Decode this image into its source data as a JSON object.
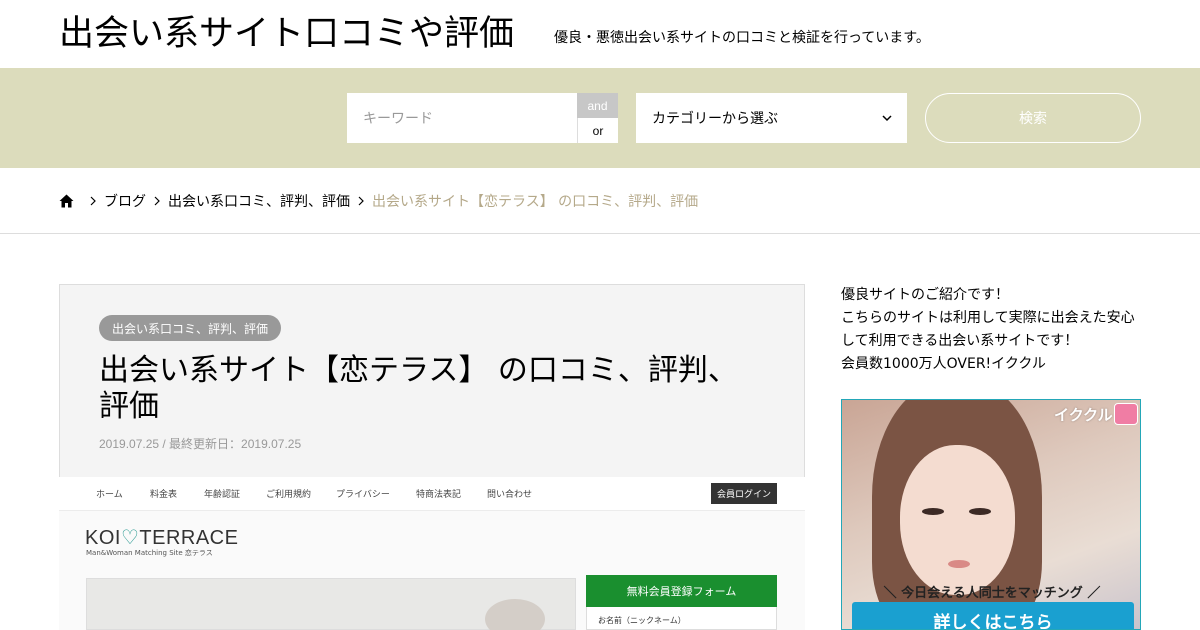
{
  "header": {
    "site_title": "出会い系サイト口コミや評価",
    "site_description": "優良・悪徳出会い系サイトの口コミと検証を行っています。"
  },
  "search": {
    "keyword_placeholder": "キーワード",
    "and_label": "and",
    "or_label": "or",
    "category_selected": "カテゴリーから選ぶ",
    "submit_label": "検索"
  },
  "breadcrumb": {
    "items": [
      "ブログ",
      "出会い系口コミ、評判、評価"
    ],
    "current": "出会い系サイト【恋テラス】 の口コミ、評判、評価"
  },
  "article": {
    "category": "出会い系口コミ、評判、評価",
    "title": "出会い系サイト【恋テラス】 の口コミ、評判、評価",
    "date": "2019.07.25 / 最終更新日：2019.07.25"
  },
  "featured_image": {
    "nav": [
      "ホーム",
      "料金表",
      "年齢認証",
      "ご利用規約",
      "プライバシー",
      "特商法表記",
      "問い合わせ"
    ],
    "login_label": "会員ログイン",
    "logo_left": "KOI",
    "logo_heart": "♡",
    "logo_right": "TERRACE",
    "logo_tagline": "Man&Woman Matching Site 恋テラス",
    "form_heading": "無料会員登録フォーム",
    "form_label": "お名前（ニックネーム）"
  },
  "sidebar": {
    "intro_lines": [
      "優良サイトのご紹介です！",
      "こちらのサイトは利用して実際に出会えた安心して利用できる出会い系サイトです！",
      "会員数1000万人OVER!イククル"
    ],
    "ad": {
      "brand": "イククル",
      "tagline": "＼ 今日会える人同士をマッチング ／",
      "cta": "詳しくはこちら"
    }
  },
  "colors": {
    "search_band": "#dcdcbc",
    "breadcrumb_current": "#b5a98a",
    "badge": "#999999",
    "ad_cta": "#1aa0d0"
  }
}
